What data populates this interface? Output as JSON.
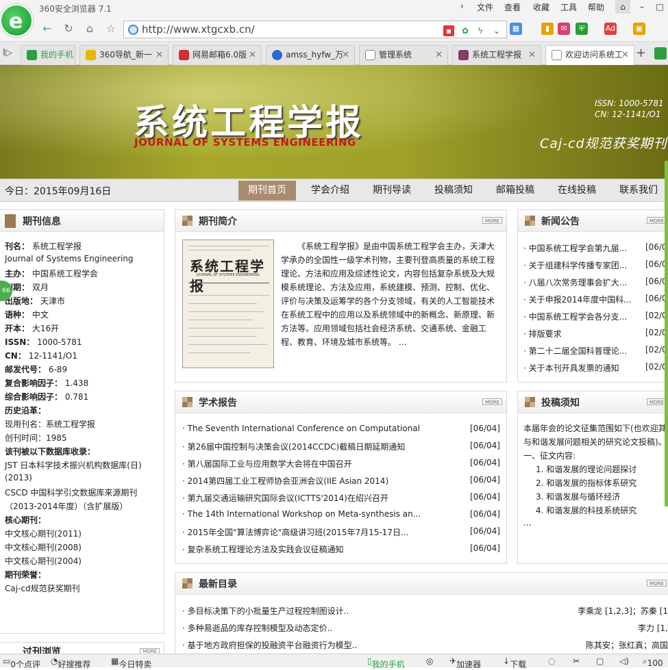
{
  "window": {
    "title": "360安全浏览器 7.1",
    "menus": [
      "文件",
      "查看",
      "收藏",
      "工具",
      "帮助"
    ]
  },
  "address": {
    "url": "http://www.xtgcxb.cn/"
  },
  "tabs": [
    {
      "label": "我的手机",
      "color": "#2ea043"
    },
    {
      "label": "360导航_新一",
      "color": "#e6b800"
    },
    {
      "label": "网易邮箱6.0版",
      "color": "#d03030"
    },
    {
      "label": "amss_hyfw_万",
      "color": "#2a6bd1"
    },
    {
      "label": "管理系统",
      "color": "#888888"
    },
    {
      "label": "系统工程学报",
      "color": "#8b3a6b"
    },
    {
      "label": "欢迎访问系统工",
      "color": "#888888"
    }
  ],
  "banner": {
    "title_cn": "系统工程学报",
    "title_en": "JOURNAL OF SYSTEMS ENGINEERING",
    "issn": "ISSN:  1000-5781",
    "cn": "CN:   12-1141/O1",
    "slogan": "Caj-cd规范获奖期刊"
  },
  "nav": {
    "today": "今日：2015年09月16日",
    "items": [
      "期刊首页",
      "学会介绍",
      "期刊导读",
      "投稿须知",
      "邮箱投稿",
      "在线投稿",
      "联系我们"
    ]
  },
  "journal_info": {
    "title": "期刊信息",
    "lines": [
      [
        "刊名：",
        "系统工程学报"
      ],
      [
        "",
        "Journal of Systems Engineering"
      ],
      [
        "主办：",
        "中国系统工程学会"
      ],
      [
        "刊期：",
        "双月"
      ],
      [
        "出版地：",
        "天津市"
      ],
      [
        "语种：",
        "中文"
      ],
      [
        "开本：",
        "大16开"
      ],
      [
        "ISSN：",
        "1000-5781"
      ],
      [
        "CN：",
        "12-1141/O1"
      ],
      [
        "邮发代号：",
        "6-89"
      ],
      [
        "复合影响因子：",
        "1.438"
      ],
      [
        "综合影响因子：",
        "0.781"
      ],
      [
        "历史沿革：",
        ""
      ],
      [
        "",
        "现用刊名：系统工程学报"
      ],
      [
        "",
        "创刊时间：1985"
      ],
      [
        "该刊被以下数据库收录：",
        ""
      ],
      [
        "",
        "JST 日本科学技术振兴机构数据库(日)"
      ],
      [
        "",
        "(2013)"
      ],
      [
        "",
        "CSCD 中国科学引文数据库来源期刊"
      ],
      [
        "",
        "（2013-2014年度）（含扩展版）"
      ],
      [
        "核心期刊：",
        ""
      ],
      [
        "",
        "中文核心期刊(2011)"
      ],
      [
        "",
        "中文核心期刊(2008)"
      ],
      [
        "",
        "中文核心期刊(2004)"
      ],
      [
        "期刊荣誉：",
        ""
      ],
      [
        "",
        "Caj-cd规范获奖期刊"
      ]
    ]
  },
  "intro": {
    "title": "期刊简介",
    "more": "MORE",
    "cover_title": "系统工程学报",
    "cover_en": "JOURNAL OF SYSTEMS ENGINEERING",
    "text": "《系统工程学报》是由中国系统工程学会主办，天津大学承办的全国性一级学术刊物，主要刊登高质量的系统工程理论、方法和应用及综述性论文，内容包括复杂系统及大规模系统理论、方法及应用，系统建模、预测、控制、优化、评价与决策及运筹学的各个分支领域，有关的人工智能技术在系统工程中的应用以及系统领域中的新概念、新原理、新方法等。应用领域包括社会经济系统、交通系统、金融工程、教育、环境及城市系统等。 ..."
  },
  "news": {
    "title": "新闻公告",
    "more": "MORE",
    "items": [
      [
        "中国系统工程学会第九届...",
        "[06/0"
      ],
      [
        "关于组建科学传播专家团...",
        "[06/0"
      ],
      [
        "八届八次常务理事会扩大...",
        "[06/0"
      ],
      [
        "关于申报2014年度中国科...",
        "[06/0"
      ],
      [
        "中国系统工程学会各分支...",
        "[02/0"
      ],
      [
        "排版要求",
        "[02/0"
      ],
      [
        "第二十二届全国科普理论...",
        "[02/0"
      ],
      [
        "关于本刊开具发票的通知",
        "[02/0"
      ]
    ]
  },
  "reports": {
    "title": "学术报告",
    "more": "MORE",
    "items": [
      [
        "The Seventh International Conference on Computational",
        "[06/04]"
      ],
      [
        "第26届中国控制与决策会议(2014CCDC)截稿日期延期通知",
        "[06/04]"
      ],
      [
        "第八届国际工业与应用数学大会将在中国召开",
        "[06/04]"
      ],
      [
        "2014第四届工业工程师协会亚洲会议(IIE Asian 2014)",
        "[06/04]"
      ],
      [
        "第九届交通运输研究国际会议(ICTTS'2014)在绍兴召开",
        "[06/04]"
      ],
      [
        "The 14th International Workshop on Meta-synthesis an...",
        "[06/04]"
      ],
      [
        "2015年全国\"算法博弈论\"高级讲习班(2015年7月15-17日...",
        "[06/04]"
      ],
      [
        "复杂系统工程理论方法及实践会议征稿通知",
        "[06/04]"
      ]
    ]
  },
  "guide": {
    "title": "投稿须知",
    "more": "MORE",
    "lines": [
      "本届年会的论文征集范围如下(也欢迎其",
      "与和谐发展问题相关的研究论文投稿)。",
      "一、征文内容:",
      "1.    和谐发展的理论问题探讨",
      "2.    和谐发展的指标体系研究",
      "3.    和谐发展与循环经济",
      "4.    和谐发展的科技系统研究",
      "..."
    ]
  },
  "catalog": {
    "title": "最新目录",
    "more": "MORE",
    "items": [
      [
        "多目标决策下的小批量生产过程控制图设计..",
        "李乘龙 [1,2,3]；苏秦 [1"
      ],
      [
        "多种易逝品的库存控制模型及动态定价..",
        "李力 [1,"
      ],
      [
        "基于地方政府担保的投融资平台融资行为模型..",
        "陈其安；张红真；高国"
      ]
    ]
  },
  "past": {
    "title": "过刊浏览",
    "more": "MORE"
  },
  "status": {
    "items": [
      "0个点评",
      "好搜推荐",
      "今日特卖",
      "我的手机",
      "加速器",
      "下载",
      "100"
    ]
  },
  "float_badge": "66"
}
